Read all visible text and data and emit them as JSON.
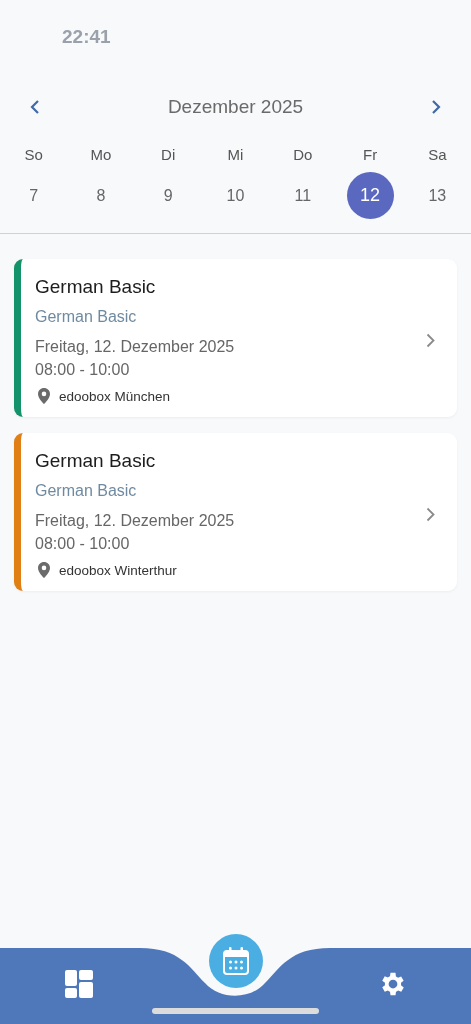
{
  "status_bar": {
    "time": "22:41"
  },
  "calendar": {
    "month": "Dezember 2025",
    "days": [
      {
        "weekday": "So",
        "day": "7",
        "selected": false
      },
      {
        "weekday": "Mo",
        "day": "8",
        "selected": false
      },
      {
        "weekday": "Di",
        "day": "9",
        "selected": false
      },
      {
        "weekday": "Mi",
        "day": "10",
        "selected": false
      },
      {
        "weekday": "Do",
        "day": "11",
        "selected": false
      },
      {
        "weekday": "Fr",
        "day": "12",
        "selected": true
      },
      {
        "weekday": "Sa",
        "day": "13",
        "selected": false
      }
    ]
  },
  "events": [
    {
      "title": "German Basic",
      "subtitle": "German Basic",
      "date": "Freitag, 12. Dezember 2025",
      "time": "08:00 - 10:00",
      "location": "edoobox München",
      "color": "#14936a"
    },
    {
      "title": "German Basic",
      "subtitle": "German Basic",
      "date": "Freitag, 12. Dezember 2025",
      "time": "08:00 - 10:00",
      "location": "edoobox Winterthur",
      "color": "#e07f14"
    }
  ],
  "bottom_nav": [
    {
      "kind": "dashboard",
      "selected": false
    },
    {
      "kind": "calendar",
      "selected": true
    },
    {
      "kind": "settings",
      "selected": false
    }
  ]
}
